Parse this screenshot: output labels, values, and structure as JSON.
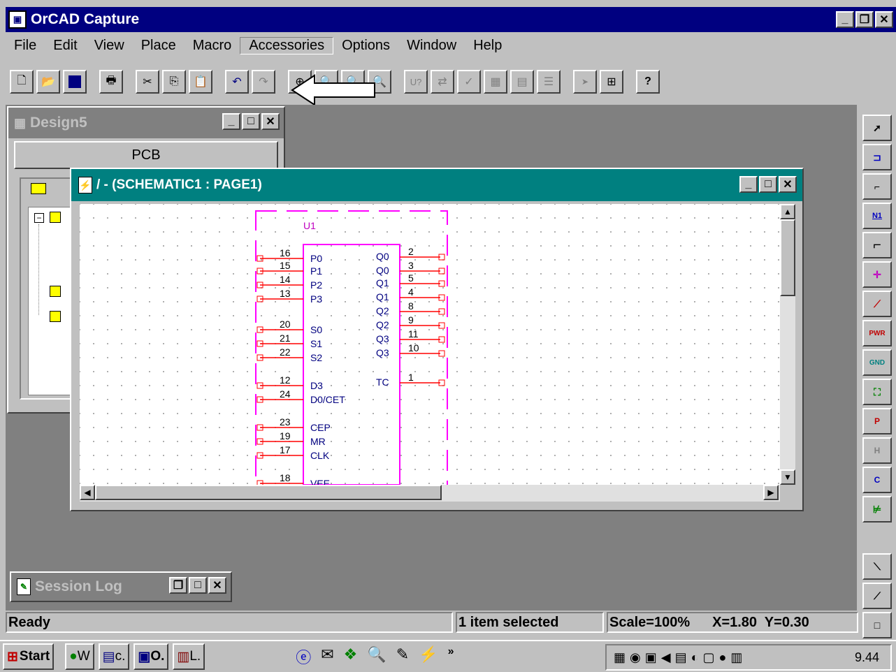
{
  "app": {
    "title": "OrCAD Capture"
  },
  "menu": [
    "File",
    "Edit",
    "View",
    "Place",
    "Macro",
    "Accessories",
    "Options",
    "Window",
    "Help"
  ],
  "toolbar": {
    "icons": [
      "new-icon",
      "open-icon",
      "save-icon",
      "print-icon",
      "cut-icon",
      "copy-icon",
      "paste-icon",
      "undo-icon",
      "redo-icon",
      "zoom-in-icon",
      "zoom-out-icon",
      "zoom-area-icon",
      "zoom-all-icon",
      "annotate-icon",
      "back-annotate-icon",
      "drc-icon",
      "netlist-icon",
      "cross-ref-icon",
      "bom-icon",
      "snap-icon",
      "project-manager-icon",
      "help-icon"
    ],
    "annotate_label": "U?"
  },
  "design": {
    "title": "Design5",
    "tab": "PCB"
  },
  "schematic": {
    "title": "/ - (SCHEMATIC1 : PAGE1)",
    "part_ref": "U1",
    "left_pins": [
      {
        "num": "16",
        "name": "P0"
      },
      {
        "num": "15",
        "name": "P1"
      },
      {
        "num": "14",
        "name": "P2"
      },
      {
        "num": "13",
        "name": "P3"
      },
      {
        "num": "20",
        "name": "S0"
      },
      {
        "num": "21",
        "name": "S1"
      },
      {
        "num": "22",
        "name": "S2"
      },
      {
        "num": "12",
        "name": "D3"
      },
      {
        "num": "24",
        "name": "D0/CET"
      },
      {
        "num": "23",
        "name": "CEP"
      },
      {
        "num": "19",
        "name": "MR"
      },
      {
        "num": "17",
        "name": "CLK"
      },
      {
        "num": "18",
        "name": "VEE"
      }
    ],
    "right_pins": [
      {
        "num": "2",
        "name": "Q0"
      },
      {
        "num": "3",
        "name": "Q0"
      },
      {
        "num": "5",
        "name": "Q1"
      },
      {
        "num": "4",
        "name": "Q1"
      },
      {
        "num": "8",
        "name": "Q2"
      },
      {
        "num": "9",
        "name": "Q2"
      },
      {
        "num": "11",
        "name": "Q3"
      },
      {
        "num": "10",
        "name": "Q3"
      },
      {
        "num": "1",
        "name": "TC"
      }
    ]
  },
  "session": {
    "title": "Session Log"
  },
  "palette": {
    "icons": [
      "select-icon",
      "place-part-icon",
      "place-wire-icon",
      "place-net-alias-icon",
      "place-bus-icon",
      "place-junction-icon",
      "place-bus-entry-icon",
      "place-power-icon",
      "place-ground-icon",
      "place-hierarchical-block-icon",
      "place-port-icon",
      "place-hierarchical-pin-icon",
      "place-off-page-connector-icon",
      "place-no-connect-icon",
      "place-line-icon",
      "place-polyline-icon",
      "place-rectangle-icon"
    ],
    "labels": {
      "net": "N1",
      "power": "PWR",
      "ground": "GND",
      "port": "P",
      "hpin": "H",
      "offpage": "C"
    }
  },
  "status": {
    "ready": "Ready",
    "selection": "1 item selected",
    "scale": "Scale=100%",
    "coords": "X=1.80  Y=0.30"
  },
  "taskbar": {
    "start": "Start",
    "tasks": [
      "W",
      "c.",
      "O.",
      "L."
    ],
    "clock": "9.44"
  }
}
